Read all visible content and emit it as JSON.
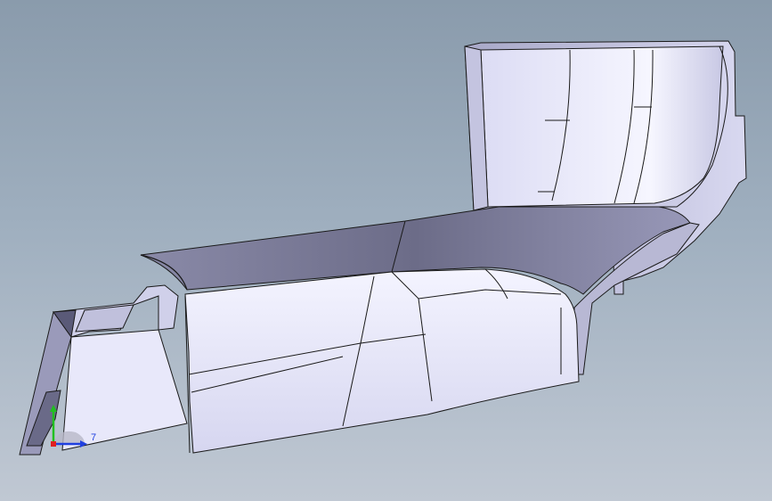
{
  "viewport": {
    "background_top": "#8a9bac",
    "background_bottom": "#c0c8d3"
  },
  "model": {
    "face_color": "#e6e6fa",
    "shade_color": "#7a7a9a",
    "edge_color": "#1a1a1a"
  },
  "triad": {
    "axis_label": "7",
    "x_color": "#2040e0",
    "y_color": "#20c020",
    "z_color": "#e02020"
  }
}
